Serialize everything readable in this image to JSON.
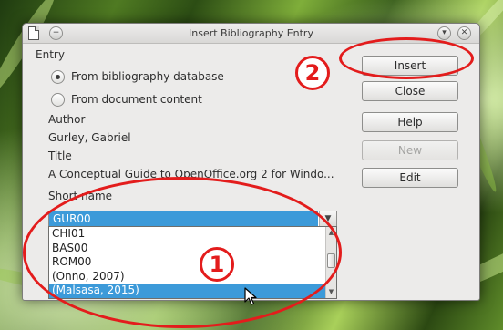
{
  "window": {
    "title": "Insert Bibliography Entry"
  },
  "entry": {
    "section_label": "Entry",
    "source_options": [
      {
        "label": "From bibliography database",
        "checked": true
      },
      {
        "label": "From document content",
        "checked": false
      }
    ],
    "author_label": "Author",
    "author_value": "Gurley, Gabriel",
    "title_label": "Title",
    "title_value": "A Conceptual Guide to OpenOffice.org 2 for Windo...",
    "short_name_label": "Short name",
    "short_name_value": "GUR00",
    "short_name_options": [
      "CHI01",
      "BAS00",
      "ROM00",
      "(Onno, 2007)",
      "(Malsasa, 2015)"
    ],
    "short_name_highlighted_option": "(Malsasa, 2015)",
    "short_name_list_scroll_position": 0.45
  },
  "buttons": {
    "insert": "Insert",
    "close": "Close",
    "help": "Help",
    "new": "New",
    "edit": "Edit"
  },
  "disabled_buttons": [
    "new"
  ],
  "annotations": {
    "marker_1": "1",
    "marker_2": "2",
    "color": "#e31c1c"
  },
  "colors": {
    "selection": "#3c9ad9",
    "dialog_background": "#ecebea"
  },
  "icons": {
    "window_icon": "document-icon",
    "window_menu": "window-menu-icon",
    "window_collapse": "chevron-down-icon",
    "window_close": "close-icon",
    "combo_arrow": "chevron-down-icon",
    "pointer": "mouse-pointer-icon"
  }
}
